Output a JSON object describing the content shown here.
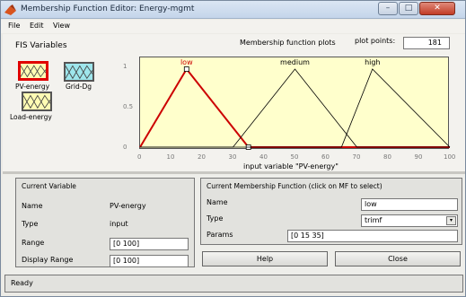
{
  "window": {
    "title": "Membership Function Editor: Energy-mgmt",
    "minimize": "–",
    "maximize": "□",
    "close": "✕"
  },
  "menu": {
    "file": "File",
    "edit": "Edit",
    "view": "View"
  },
  "fis": {
    "title": "FIS Variables",
    "variables": [
      {
        "label": "PV-energy",
        "kind": "input",
        "selected": true
      },
      {
        "label": "Grid-Dg",
        "kind": "output",
        "selected": false
      },
      {
        "label": "Load-energy",
        "kind": "input",
        "selected": false
      }
    ]
  },
  "plot": {
    "title": "Membership function plots",
    "points_label": "plot points:",
    "points_value": "181",
    "xlabel": "input variable \"PV-energy\"",
    "xticks": [
      "0",
      "10",
      "20",
      "30",
      "40",
      "50",
      "60",
      "70",
      "80",
      "90",
      "100"
    ],
    "yticks": [
      "1",
      "0.5",
      "0"
    ]
  },
  "chart_data": {
    "type": "line",
    "xlim": [
      0,
      100
    ],
    "ylim": [
      0,
      1
    ],
    "xlabel": "input variable \"PV-energy\"",
    "series": [
      {
        "name": "low",
        "params": [
          0,
          15,
          35
        ],
        "color": "#cc0000",
        "selected": true
      },
      {
        "name": "medium",
        "params": [
          30,
          50,
          70
        ],
        "color": "#000000",
        "selected": false
      },
      {
        "name": "high",
        "params": [
          65,
          75,
          100
        ],
        "color": "#000000",
        "selected": false
      }
    ]
  },
  "current_variable": {
    "title": "Current Variable",
    "name_label": "Name",
    "name_value": "PV-energy",
    "type_label": "Type",
    "type_value": "input",
    "range_label": "Range",
    "range_value": "[0 100]",
    "display_range_label": "Display Range",
    "display_range_value": "[0 100]"
  },
  "current_mf": {
    "title": "Current Membership Function (click on MF to select)",
    "name_label": "Name",
    "name_value": "low",
    "type_label": "Type",
    "type_value": "trimf",
    "params_label": "Params",
    "params_value": "[0 15 35]"
  },
  "buttons": {
    "help": "Help",
    "close": "Close"
  },
  "status": "Ready"
}
